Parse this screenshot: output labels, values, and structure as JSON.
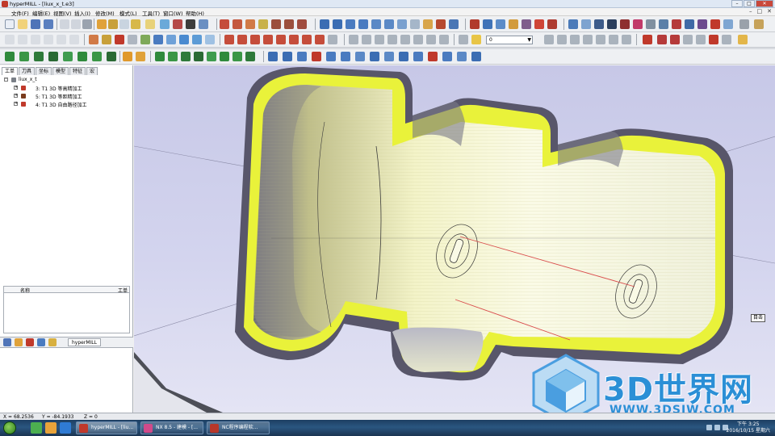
{
  "window": {
    "title": "hyperMILL - [liux_x_t.e3]"
  },
  "menu": {
    "items": [
      "文件(F)",
      "编辑(E)",
      "视图(V)",
      "插入(I)",
      "修改(M)",
      "模式(L)",
      "工具(T)",
      "窗口(W)",
      "帮助(H)"
    ]
  },
  "toolbar": {
    "layer_combo": "0"
  },
  "panel": {
    "tabs": [
      "工单",
      "刀具",
      "坐标",
      "模型",
      "特征",
      "宏"
    ],
    "tree": {
      "root": "liux_x_t",
      "jobs": [
        {
          "label": "3: T1 3D 等高精加工",
          "icon": "job-icon",
          "color": "#c0392b"
        },
        {
          "label": "5: T1 3D 等距精加工",
          "icon": "job-icon",
          "color": "#7a3b1d"
        },
        {
          "label": "4: T1 3D 自由路径加工",
          "icon": "job-icon",
          "color": "#c0392b"
        }
      ]
    },
    "list": {
      "col_name": "名称",
      "col_tool": "工单"
    },
    "bottom_tab": "hyperMILL"
  },
  "viewport": {
    "popup": "目击"
  },
  "watermark": {
    "title": "3D世界网",
    "url": "WWW.3DSJW.COM"
  },
  "status": {
    "x": "X = 68.2536",
    "y": "Y = -84.1933",
    "z": "Z = 0"
  },
  "taskbar": {
    "tasks": [
      {
        "label": "hyperMILL - [liu..."
      },
      {
        "label": "NX 8.5 - 建模 - [..."
      },
      {
        "label": "NC程序编程软..."
      }
    ],
    "time": "下午 3:25",
    "date": "2016/10/15 星期六"
  },
  "colors": {
    "part_yellow": "#e9f23a",
    "toolpath_red": "#d94b4b",
    "brand_blue": "#2b8fd6"
  }
}
